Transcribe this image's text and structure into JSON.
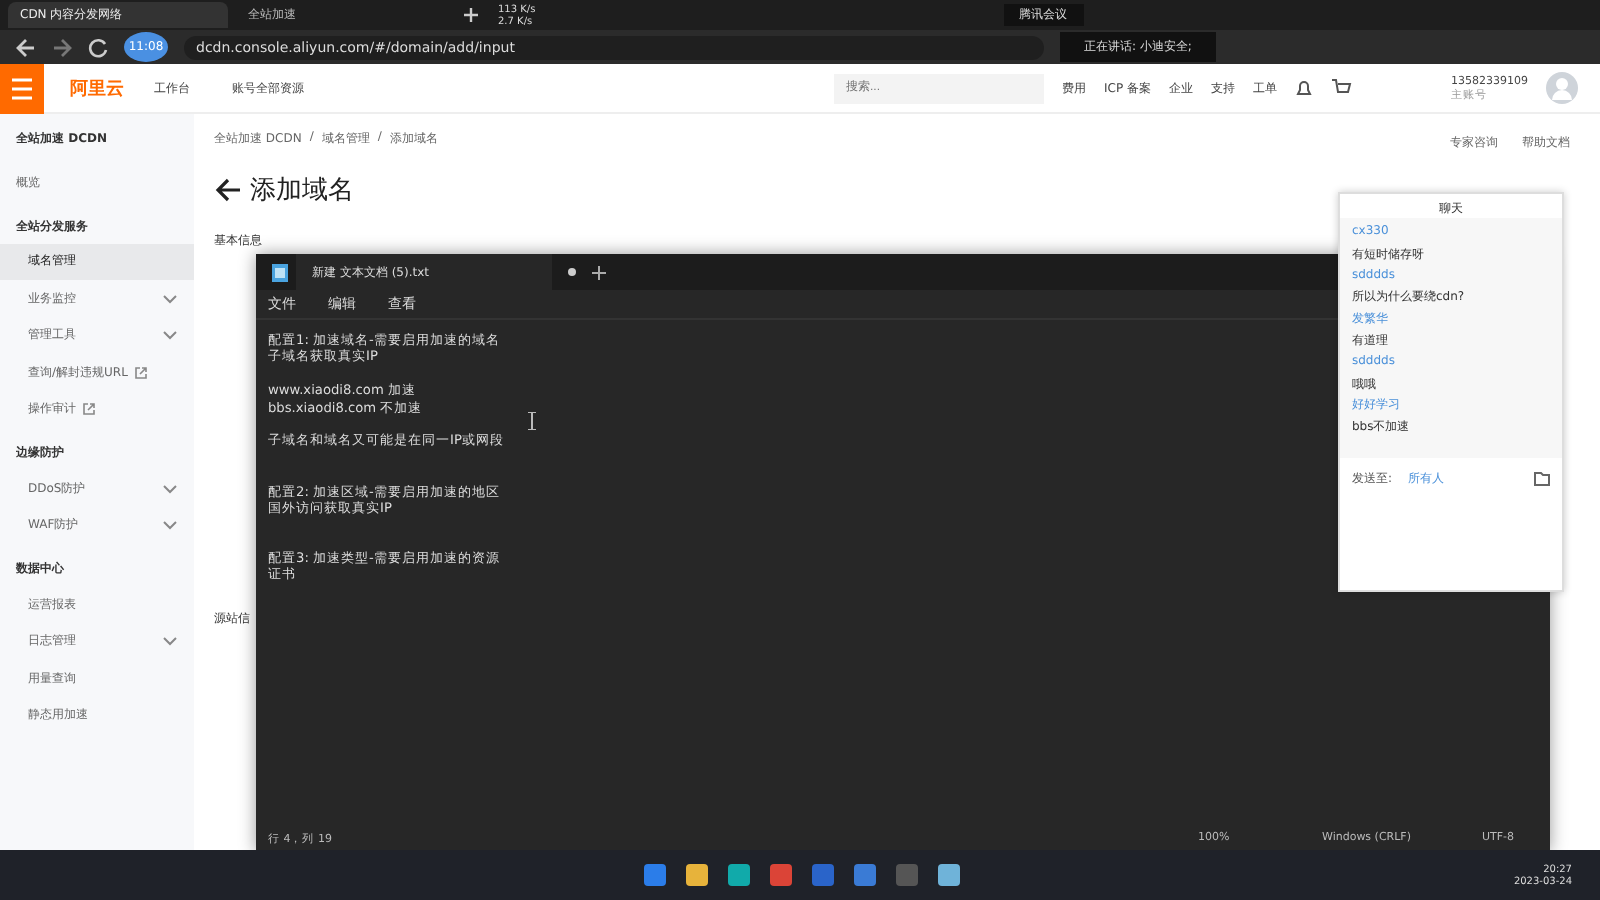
{
  "browser": {
    "tabs": [
      {
        "title": "CDN 内容分发网络",
        "selected": true
      },
      {
        "title": "全站加速",
        "selected": false
      }
    ],
    "timer": "11:08",
    "speed": [
      "113 K/s",
      "2.7 K/s"
    ],
    "meeting": "腾讯会议",
    "url": "dcdn.console.aliyun.com/#/domain/add/input",
    "speaking": "正在讲话: 小迪安全;"
  },
  "header": {
    "logo": "阿里云",
    "workbench": "工作台",
    "resources": "账号全部资源",
    "search": {
      "placeholder": "搜索..."
    },
    "nav": [
      "费用",
      "ICP 备案",
      "企业",
      "支持",
      "工单"
    ],
    "account": "13582339109",
    "account_type": "主账号"
  },
  "sidebar": {
    "title": "全站加速 DCDN",
    "overview": "概览",
    "sections": [
      {
        "title": "全站分发服务",
        "items": [
          {
            "label": "域名管理",
            "selected": true,
            "expandable": false,
            "external": false
          },
          {
            "label": "业务监控",
            "selected": false,
            "expandable": true,
            "external": false
          },
          {
            "label": "管理工具",
            "selected": false,
            "expandable": true,
            "external": false
          },
          {
            "label": "查询/解封违规URL",
            "selected": false,
            "expandable": false,
            "external": true
          },
          {
            "label": "操作审计",
            "selected": false,
            "expandable": false,
            "external": true
          }
        ]
      },
      {
        "title": "边缘防护",
        "items": [
          {
            "label": "DDoS防护",
            "selected": false,
            "expandable": true,
            "external": false
          },
          {
            "label": "WAF防护",
            "selected": false,
            "expandable": true,
            "external": false
          }
        ]
      },
      {
        "title": "数据中心",
        "items": [
          {
            "label": "运营报表",
            "selected": false,
            "expandable": false,
            "external": false
          },
          {
            "label": "日志管理",
            "selected": false,
            "expandable": true,
            "external": false
          },
          {
            "label": "用量查询",
            "selected": false,
            "expandable": false,
            "external": false
          },
          {
            "label": "静态用加速",
            "selected": false,
            "expandable": false,
            "external": false
          }
        ]
      }
    ]
  },
  "main": {
    "breadcrumb": [
      "全站加速 DCDN",
      "域名管理",
      "添加域名"
    ],
    "breadcrumb_separator": "/",
    "title": "添加域名",
    "links": [
      "专家咨询",
      "帮助文档"
    ],
    "section_1": "基本信息",
    "section_2": "源站信"
  },
  "notepad": {
    "tab": "新建 文本文档 (5).txt",
    "menu": [
      "文件",
      "编辑",
      "查看"
    ],
    "lines": [
      {
        "kind": "text",
        "text": "配置1: 加速域名-需要启用加速的域名"
      },
      {
        "kind": "text",
        "text": "子域名获取真实IP"
      },
      {
        "kind": "blank"
      },
      {
        "kind": "text",
        "text": "www.xiaodi8.com 加速"
      },
      {
        "kind": "text",
        "text": "bbs.xiaodi8.com 不加速"
      },
      {
        "kind": "blank"
      },
      {
        "kind": "text",
        "text": "子域名和域名又可能是在同一IP或网段"
      },
      {
        "kind": "blank"
      },
      {
        "kind": "blank"
      },
      {
        "kind": "text",
        "text": "配置2: 加速区域-需要启用加速的地区"
      },
      {
        "kind": "text",
        "text": "国外访问获取真实IP"
      },
      {
        "kind": "blank"
      },
      {
        "kind": "blank"
      },
      {
        "kind": "text",
        "text": "配置3: 加速类型-需要启用加速的资源"
      },
      {
        "kind": "text",
        "text": "证书"
      }
    ],
    "status": [
      "行 4，列 19",
      "100%",
      "Windows (CRLF)",
      "UTF-8"
    ]
  },
  "chat": {
    "title": "聊天",
    "messages": [
      {
        "user": "cx330",
        "text": "有短时储存呀"
      },
      {
        "user": "sdddds",
        "text": "所以为什么要绕cdn?"
      },
      {
        "user": "发繁华",
        "text": "有道理"
      },
      {
        "user": "sdddds",
        "text": "哦哦"
      },
      {
        "user": "好好学习",
        "text": "bbs不加速"
      }
    ],
    "send_label": "发送至:",
    "recipient": "所有人"
  },
  "taskbar": {
    "time": "20:27",
    "date": "2023-03-24"
  }
}
